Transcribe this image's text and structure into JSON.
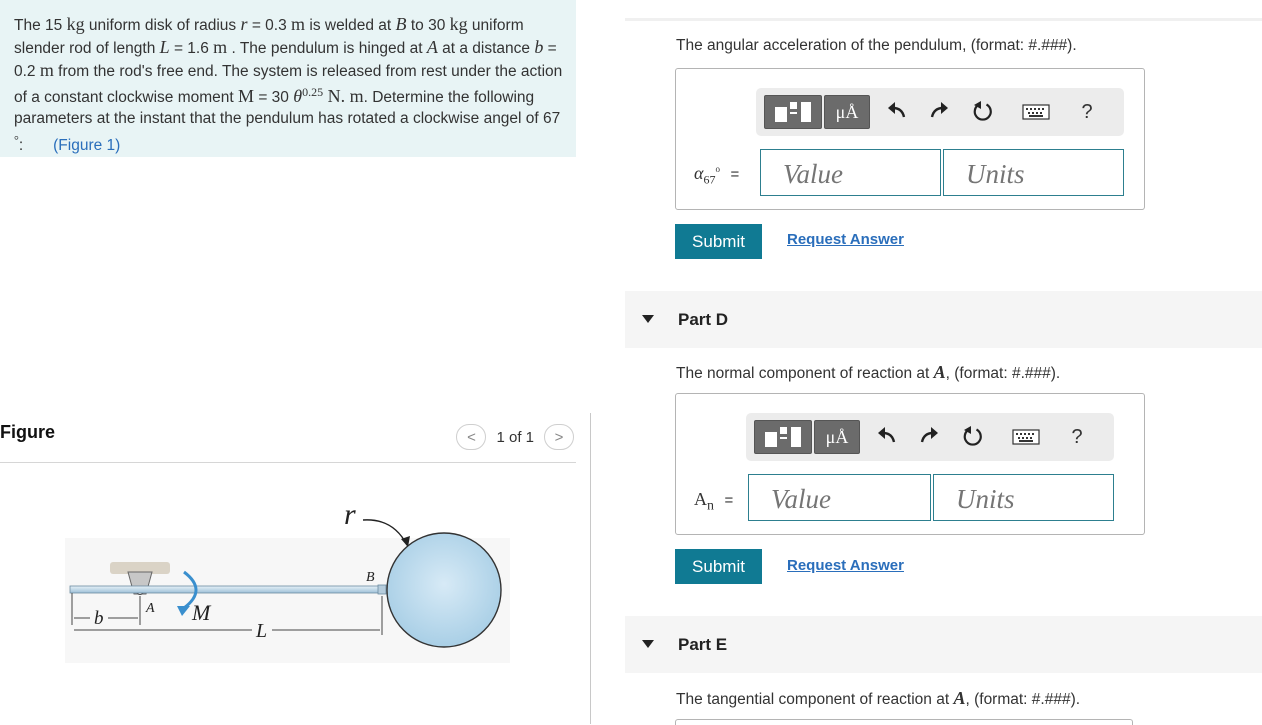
{
  "problem": {
    "p1": "The 15 ",
    "u_kg1": "kg",
    "p2": " uniform disk of radius ",
    "v_r": "r",
    "p3": " = 0.3 ",
    "u_m1": "m",
    "p4": " is welded at ",
    "v_B": "B",
    "p5": " to 30 ",
    "u_kg2": "kg",
    "p6": " uniform slender rod of length ",
    "v_L": "L",
    "p7": " = 1.6 ",
    "u_m2": "m",
    "p8": " . The pendulum is hinged at ",
    "v_A": "A",
    "p9": " at a distance ",
    "v_b": "b",
    "p10": " = 0.2 ",
    "u_m3": "m",
    "p11": " from the rod's free end. The system is released from rest under the action of a constant clockwise moment ",
    "v_M": "M",
    "p12": " = 30 ",
    "v_theta": "θ",
    "exp": "0.25",
    "u_Nm": " N. m",
    "p13": ". Determine the following parameters at the instant that the pendulum has rotated a clockwise angel of 67 ",
    "deg": "°",
    "p14": ":",
    "figure_link": "(Figure 1)"
  },
  "figure": {
    "title": "Figure",
    "pager": "1 of 1",
    "prev_glyph": "<",
    "next_glyph": ">",
    "labels": {
      "r": "r",
      "B": "B",
      "A": "A",
      "b": "b",
      "M": "M",
      "L": "L"
    }
  },
  "part_c": {
    "question_pre": "The angular acceleration of the pendulum, (format: #.###).",
    "var_main": "α",
    "var_sub": "67",
    "var_sup": "o",
    "eq": "=",
    "value_placeholder": "Value",
    "units_placeholder": "Units",
    "submit": "Submit",
    "request": "Request Answer"
  },
  "part_d": {
    "title": "Part D",
    "question_pre": "The normal component of reaction at ",
    "question_var": "A",
    "question_post": ", (format: #.###).",
    "var_main": "A",
    "var_sub": "n",
    "eq": "=",
    "value_placeholder": "Value",
    "units_placeholder": "Units",
    "submit": "Submit",
    "request": "Request Answer"
  },
  "part_e": {
    "title": "Part E",
    "question_pre": "The tangential component of reaction at ",
    "question_var": "A",
    "question_post": ", (format: #.###)."
  },
  "toolbar": {
    "mu_label": "μÅ",
    "help_label": "?",
    "icons": [
      "templates-icon",
      "micro-angstrom-icon",
      "undo-icon",
      "redo-icon",
      "reset-icon",
      "keyboard-icon",
      "help-icon"
    ]
  },
  "colors": {
    "accent": "#107a93",
    "link": "#2a6ebb",
    "problem_bg": "#e8f4f5",
    "field_border": "#2d7f8f"
  }
}
